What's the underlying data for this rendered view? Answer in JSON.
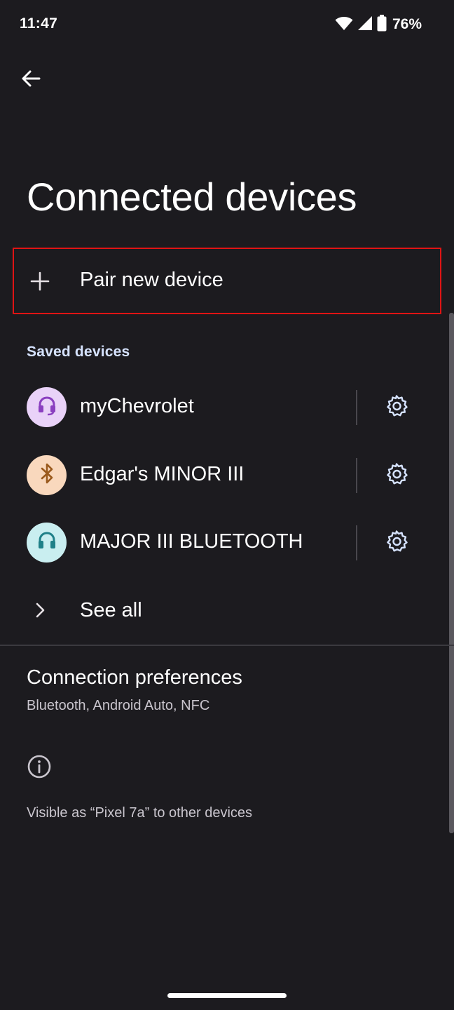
{
  "status_bar": {
    "time": "11:47",
    "battery_percent": "76%",
    "wifi_icon": "wifi-icon",
    "signal_icon": "cell-signal-icon",
    "battery_icon": "battery-icon"
  },
  "toolbar": {
    "back_icon": "arrow-back-icon"
  },
  "page": {
    "title": "Connected devices"
  },
  "pair": {
    "label": "Pair new device",
    "icon": "plus-icon",
    "highlight_color": "#e01414"
  },
  "saved": {
    "header": "Saved devices",
    "devices": [
      {
        "name": "myChevrolet",
        "icon": "headset-icon",
        "avatar_bg": "#e9d2f8",
        "icon_color": "#8a3fc0"
      },
      {
        "name": "Edgar's MINOR III",
        "icon": "bluetooth-icon",
        "avatar_bg": "#f9d8bd",
        "icon_color": "#9a5a1d"
      },
      {
        "name": "MAJOR III BLUETOOTH",
        "icon": "headphones-icon",
        "avatar_bg": "#c9eef0",
        "icon_color": "#1f8088"
      }
    ],
    "settings_icon": "gear-icon",
    "see_all_label": "See all",
    "see_all_icon": "chevron-right-icon"
  },
  "prefs": {
    "title": "Connection preferences",
    "subtitle": "Bluetooth, Android Auto, NFC"
  },
  "footer": {
    "info_icon": "info-icon",
    "visible_as": "Visible as “Pixel 7a” to other devices"
  },
  "colors": {
    "background": "#1c1b1f",
    "accent_header": "#d6e3ff"
  }
}
